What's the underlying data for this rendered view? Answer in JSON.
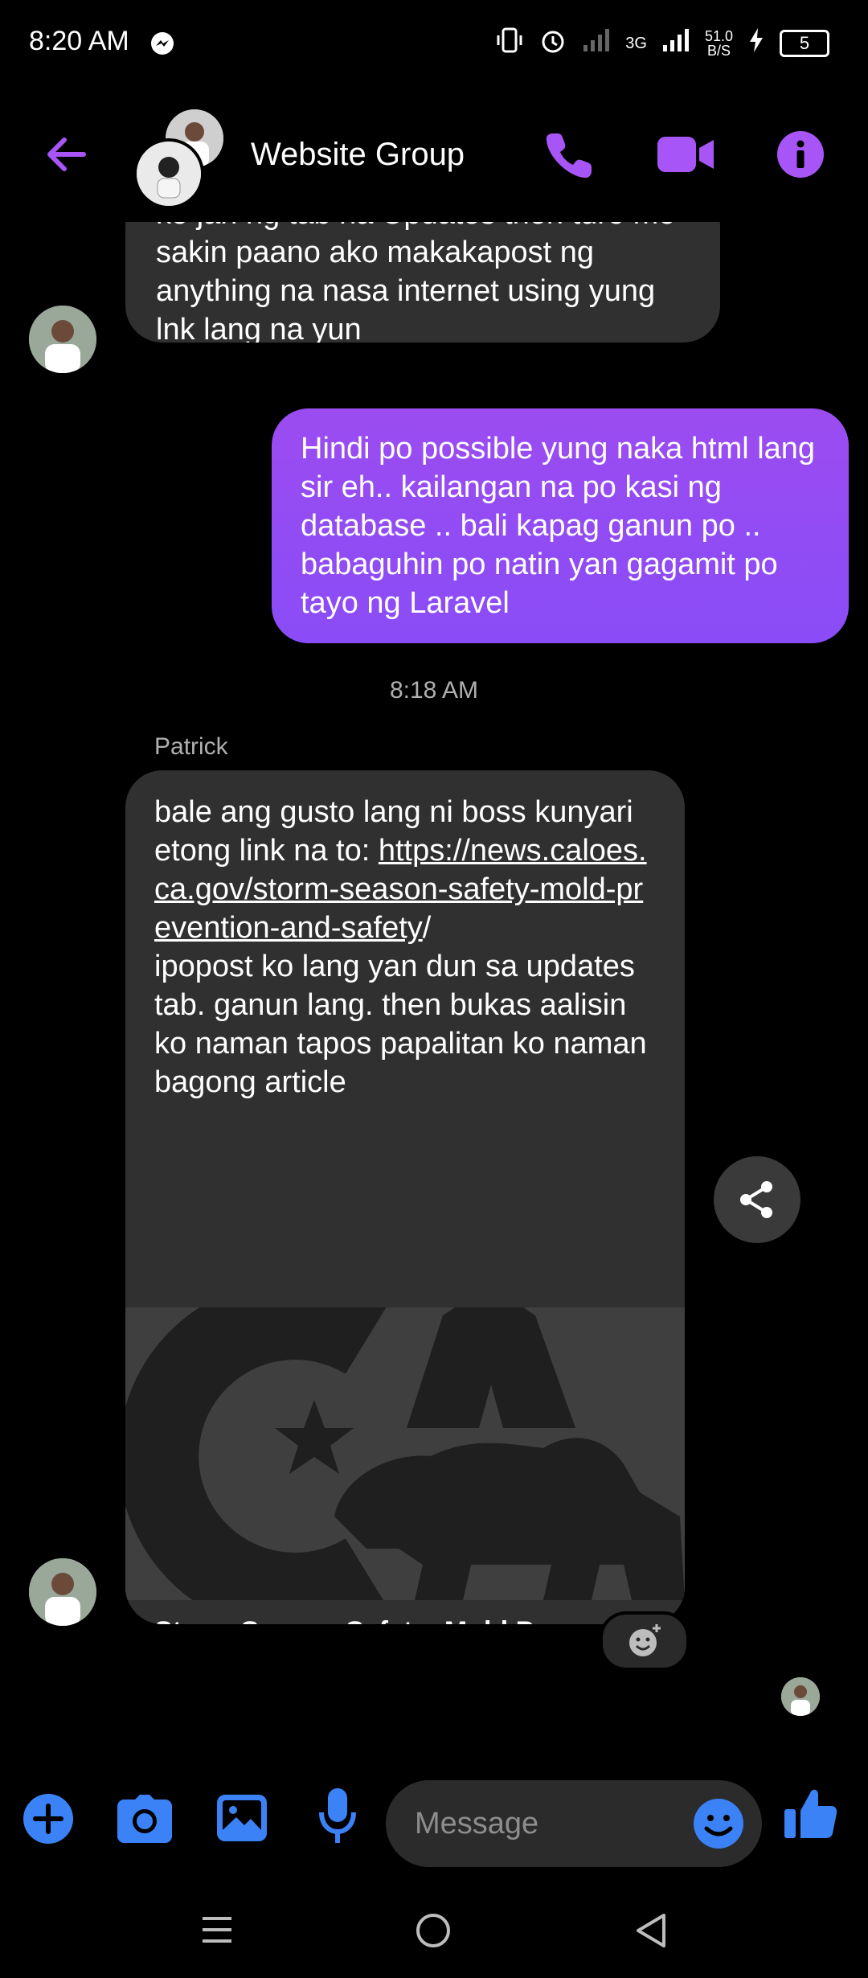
{
  "status_bar": {
    "time": "8:20 AM",
    "network": "3G",
    "speed_value": "51.0",
    "speed_unit": "B/S",
    "battery": "5"
  },
  "header": {
    "title": "Website Group",
    "accent_color": "#a855f7"
  },
  "messages": {
    "partial_top": {
      "text": "ko jan ng tab na Updates then turo mo sakin paano ako makakapost ng anything na nasa internet using yung lnk lang na yun"
    },
    "sent": {
      "text": "Hindi po possible yung naka html lang sir eh.. kailangan na po kasi ng database .. bali kapag ganun po .. babaguhin po natin yan gagamit po tayo ng Laravel"
    },
    "timestamp": "8:18 AM",
    "patrick": {
      "sender": "Patrick",
      "intro": "bale ang gusto lang ni boss kunyari etong link na to: ",
      "link": "https://news.caloes.ca.gov/storm-season-safety-mold-prevention-and-safety",
      "link_tail": "/",
      "body": "ipopost ko lang yan dun sa updates tab. ganun lang. then bukas aalisin ko naman tapos papalitan ko naman bagong article",
      "preview_title": "Storm Season Safety: Mold Prevention and Safety | Cal OES News"
    }
  },
  "composer": {
    "placeholder": "Message"
  }
}
